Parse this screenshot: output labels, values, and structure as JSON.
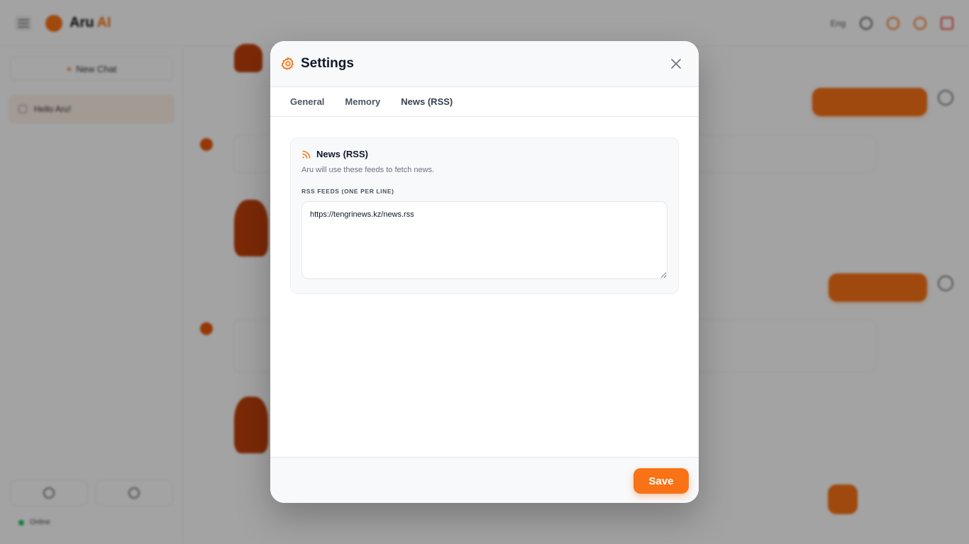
{
  "app": {
    "brand": "Aru",
    "brand_suffix": "AI",
    "language": "Eng",
    "new_chat": "New Chat",
    "chat_history": [
      {
        "title": "Hello Aru!"
      }
    ],
    "status": "Online",
    "colors": {
      "accent": "#f97316",
      "status_online": "#22c55e"
    }
  },
  "settings": {
    "title": "Settings",
    "tabs": [
      {
        "label": "General"
      },
      {
        "label": "Memory"
      },
      {
        "label": "News (RSS)",
        "active": true
      }
    ],
    "rss": {
      "title": "News (RSS)",
      "description": "Aru will use these feeds to fetch news.",
      "field_label": "RSS FEEDS (ONE PER LINE)",
      "feeds_value": "https://tengrinews.kz/news.rss"
    },
    "save_label": "Save"
  },
  "icons": {
    "header": "gear-icon",
    "close": "close-icon",
    "rss": "rss-icon"
  }
}
